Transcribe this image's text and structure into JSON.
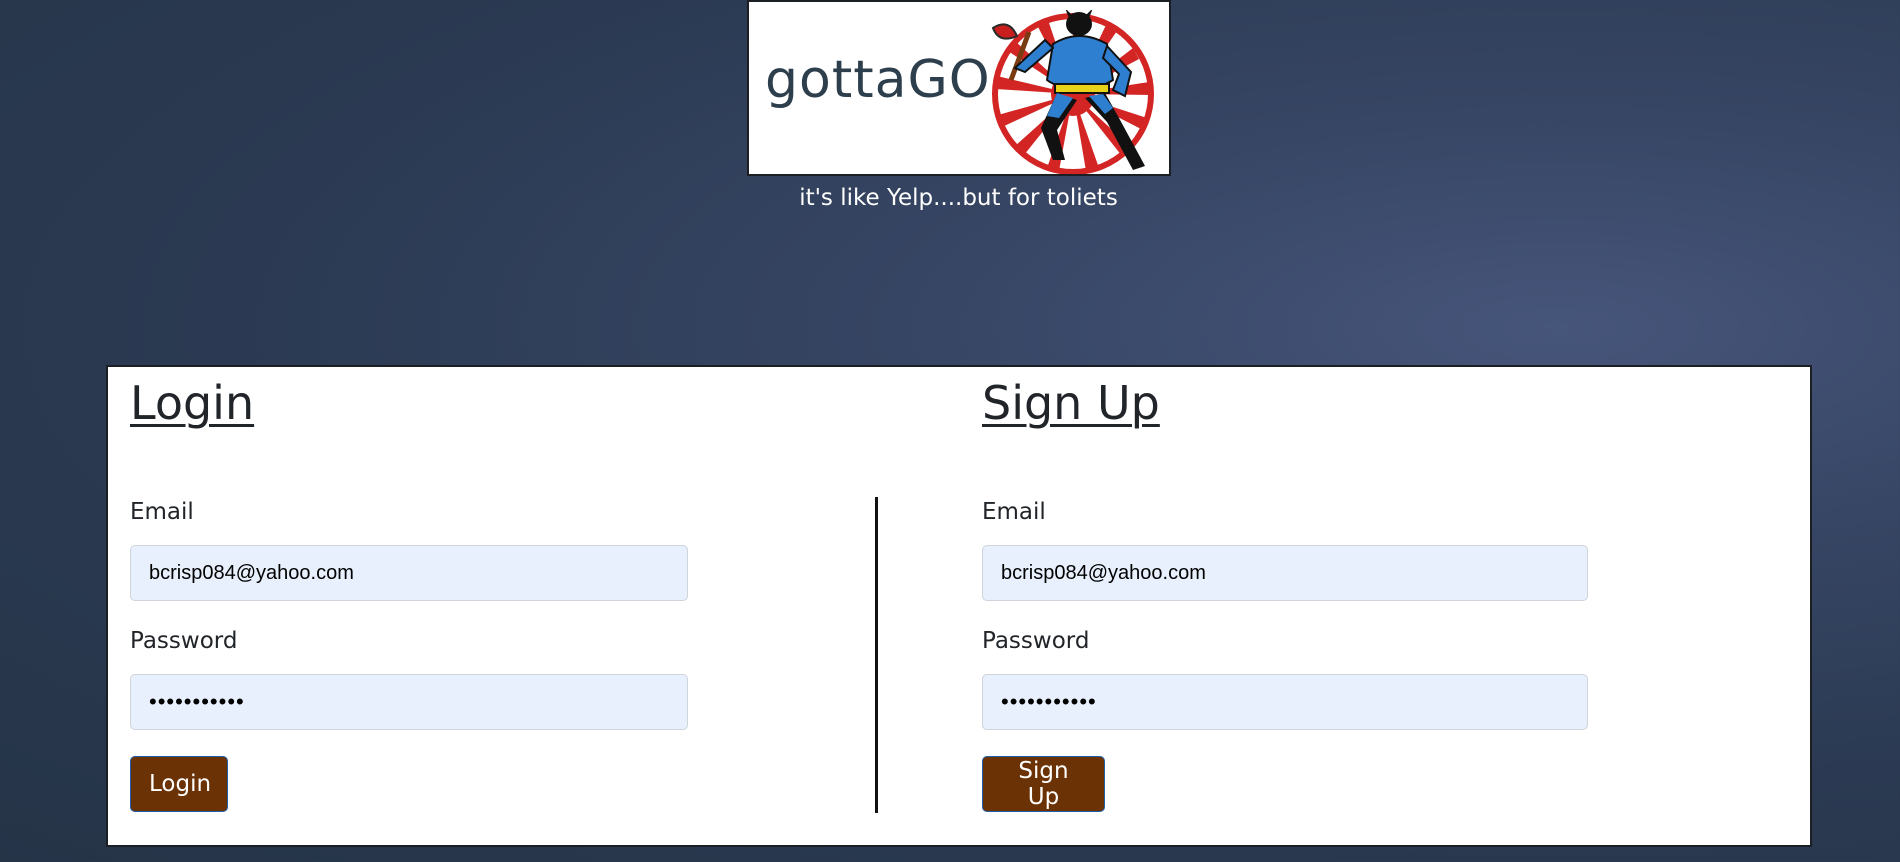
{
  "header": {
    "logo_text": "gottaGO",
    "logo_alt": "gottaGO superhero with plunger logo",
    "tagline": "it's like Yelp....but for toliets"
  },
  "login": {
    "title": "Login",
    "email_label": "Email",
    "email_value": "bcrisp084@yahoo.com",
    "password_label": "Password",
    "password_value": "•••••••••••",
    "button_label": "Login"
  },
  "signup": {
    "title": "Sign Up",
    "email_label": "Email",
    "email_value": "bcrisp084@yahoo.com",
    "password_label": "Password",
    "password_value": "•••••••••••",
    "button_label": "Sign Up"
  },
  "colors": {
    "button_bg": "#6b3205",
    "input_bg": "#e8f0fe",
    "page_bg": "#2b3a52"
  }
}
